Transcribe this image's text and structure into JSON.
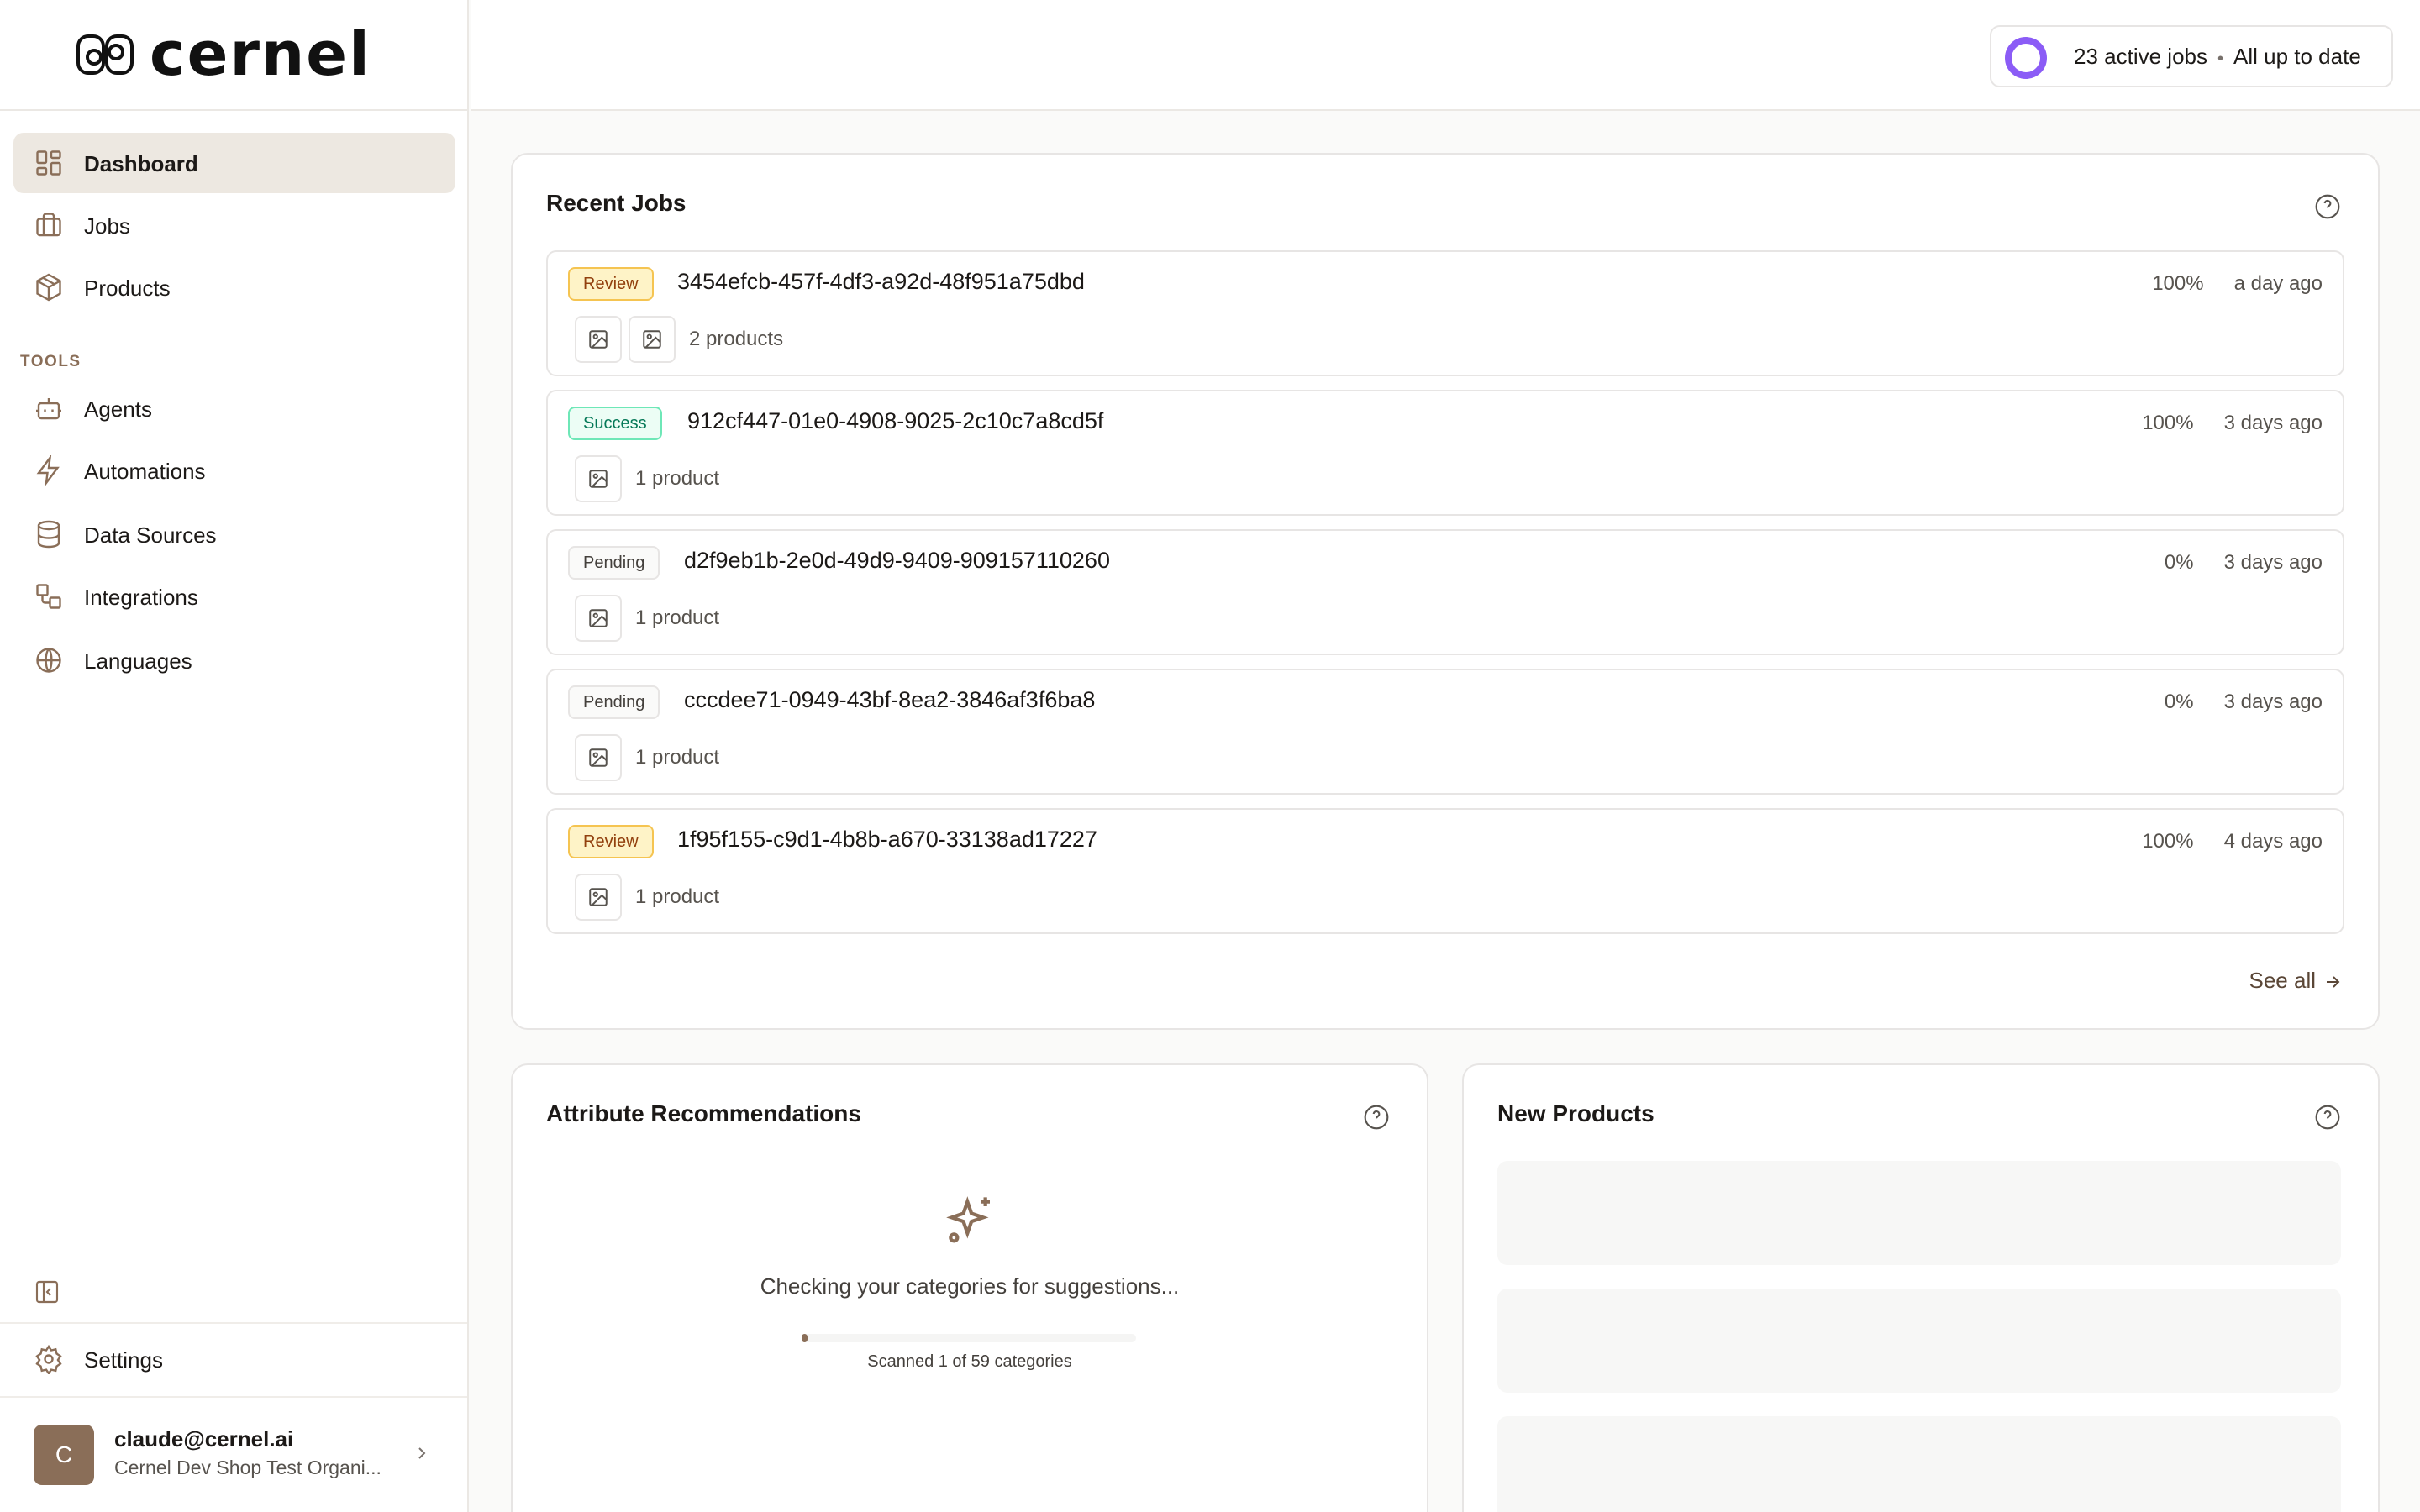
{
  "brand": {
    "name": "cernel"
  },
  "header": {
    "jobs_status": {
      "active": "23 active jobs",
      "separator": "•",
      "status": "All up to date"
    }
  },
  "sidebar": {
    "items": [
      {
        "label": "Dashboard",
        "icon": "dashboard-icon",
        "active": true
      },
      {
        "label": "Jobs",
        "icon": "briefcase-icon"
      },
      {
        "label": "Products",
        "icon": "package-icon"
      }
    ],
    "tools_label": "TOOLS",
    "tools": [
      {
        "label": "Agents",
        "icon": "bot-icon"
      },
      {
        "label": "Automations",
        "icon": "lightning-icon"
      },
      {
        "label": "Data Sources",
        "icon": "database-icon"
      },
      {
        "label": "Integrations",
        "icon": "integrations-icon"
      },
      {
        "label": "Languages",
        "icon": "globe-icon"
      }
    ],
    "settings_label": "Settings",
    "user": {
      "initial": "C",
      "email": "claude@cernel.ai",
      "org": "Cernel Dev Shop Test Organi..."
    }
  },
  "recent_jobs": {
    "title": "Recent Jobs",
    "see_all": "See all",
    "jobs": [
      {
        "status": "Review",
        "id": "3454efcb-457f-4df3-a92d-48f951a75dbd",
        "progress": "100%",
        "time": "a day ago",
        "products": "2 products",
        "thumbs": 2
      },
      {
        "status": "Success",
        "id": "912cf447-01e0-4908-9025-2c10c7a8cd5f",
        "progress": "100%",
        "time": "3 days ago",
        "products": "1 product",
        "thumbs": 1
      },
      {
        "status": "Pending",
        "id": "d2f9eb1b-2e0d-49d9-9409-909157110260",
        "progress": "0%",
        "time": "3 days ago",
        "products": "1 product",
        "thumbs": 1
      },
      {
        "status": "Pending",
        "id": "cccdee71-0949-43bf-8ea2-3846af3f6ba8",
        "progress": "0%",
        "time": "3 days ago",
        "products": "1 product",
        "thumbs": 1
      },
      {
        "status": "Review",
        "id": "1f95f155-c9d1-4b8b-a670-33138ad17227",
        "progress": "100%",
        "time": "4 days ago",
        "products": "1 product",
        "thumbs": 1
      }
    ]
  },
  "attribute_recommendations": {
    "title": "Attribute Recommendations",
    "message": "Checking your categories for suggestions...",
    "scan_progress": 0.017,
    "scanned_text": "Scanned 1 of 59 categories"
  },
  "new_products": {
    "title": "New Products"
  },
  "colors": {
    "accent": "#8a6e58",
    "active_bg": "#ede8e1",
    "ring": "#8b5cf6",
    "review": "#f5c451",
    "success": "#6ee7b7"
  }
}
